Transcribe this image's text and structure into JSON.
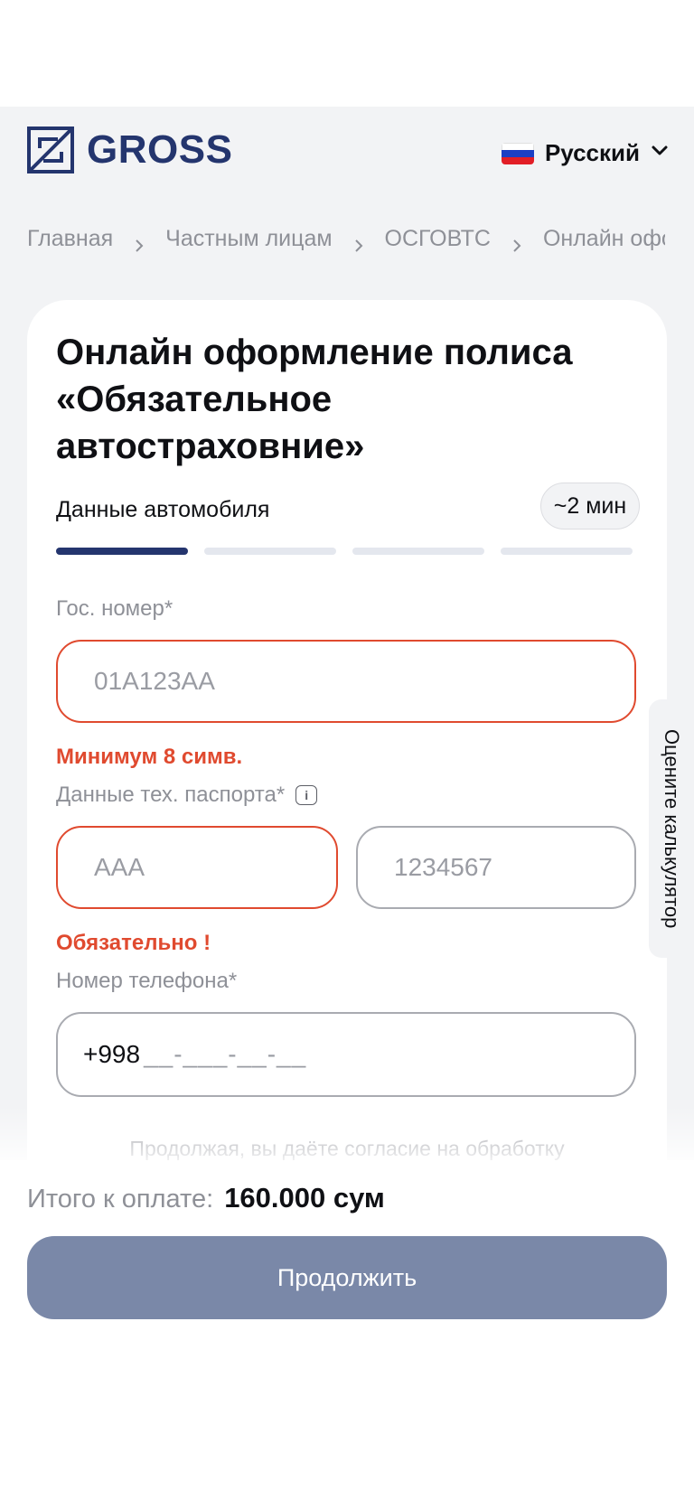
{
  "header": {
    "logo_text": "GROSS",
    "language": {
      "label": "Русский",
      "flag_colors": [
        "#ffffff",
        "#1c3fc4",
        "#e21e26"
      ]
    }
  },
  "breadcrumb": [
    "Главная",
    "Частным лицам",
    "ОСГОВТС",
    "Онлайн оформление"
  ],
  "form": {
    "title": "Онлайн оформление полиса «Обязательное автостраховние»",
    "step_label": "Данные автомобиля",
    "time_estimate": "~2 мин",
    "progress": {
      "total_steps": 4,
      "current_step": 1
    },
    "plate": {
      "label": "Гос. номер*",
      "placeholder": "01A123AA",
      "error": "Минимум 8 симв."
    },
    "tech_passport": {
      "label": "Данные тех. паспорта*",
      "series_placeholder": "AAA",
      "number_placeholder": "1234567",
      "error": "Обязательно !"
    },
    "phone": {
      "label": "Номер телефона*",
      "prefix": "+998",
      "mask": "__-___-__-__"
    },
    "consent": "Продолжая, вы даёте согласие на обработку"
  },
  "side_tab": {
    "label": "Оцените калькулятор"
  },
  "footer": {
    "total_label": "Итого к оплате:",
    "total_value": "160.000 сум",
    "continue_label": "Продолжить"
  },
  "colors": {
    "brand": "#24356e",
    "error": "#e04a2f",
    "button_disabled": "#7a88a8",
    "page_bg": "#f2f3f5"
  }
}
